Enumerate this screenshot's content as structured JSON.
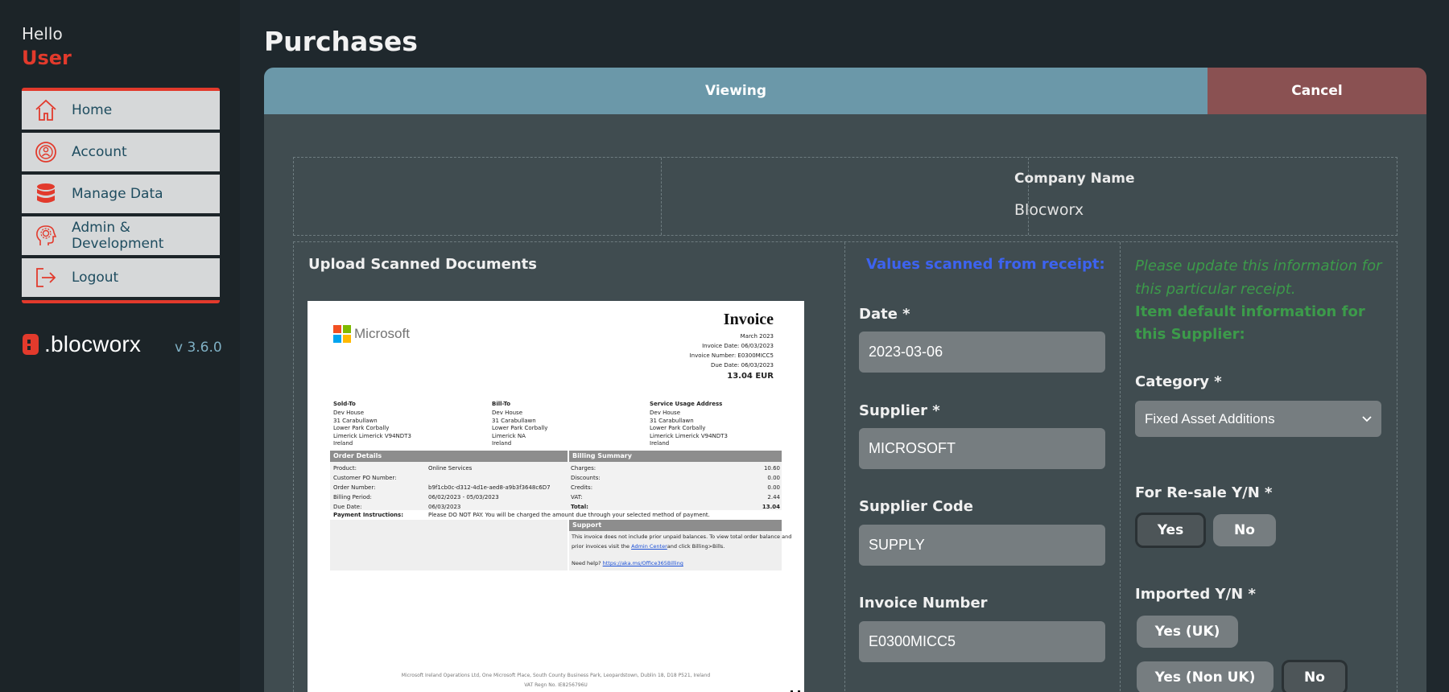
{
  "sidebar": {
    "greeting": "Hello",
    "username": "User",
    "items": [
      {
        "label": "Home"
      },
      {
        "label": "Account"
      },
      {
        "label": "Manage Data"
      },
      {
        "label": "Admin &",
        "label2": "Development"
      },
      {
        "label": "Logout"
      }
    ],
    "brand": ".blocworx",
    "version": "v 3.6.0"
  },
  "page": {
    "title": "Purchases",
    "viewing_label": "Viewing",
    "cancel_label": "Cancel"
  },
  "company": {
    "label": "Company Name",
    "value": "Blocworx"
  },
  "upload": {
    "title": "Upload Scanned Documents"
  },
  "scanned": {
    "title": "Values scanned from receipt:",
    "fields": {
      "date_label": "Date *",
      "date_value": "2023-03-06",
      "supplier_label": "Supplier *",
      "supplier_value": "MICROSOFT",
      "supplier_code_label": "Supplier Code",
      "supplier_code_value": "SUPPLY",
      "invoice_number_label": "Invoice Number",
      "invoice_number_value": "E0300MICC5"
    }
  },
  "defaults": {
    "hint_italic": "Please update this information for this particular receipt.",
    "hint_bold": "Item default information for this Supplier:",
    "category_label": "Category *",
    "category_value": "Fixed Asset Additions",
    "resale_label": "For Re-sale Y/N *",
    "resale_yes": "Yes",
    "resale_no": "No",
    "imported_label": "Imported Y/N *",
    "imported_yes_uk": "Yes (UK)",
    "imported_yes_non_uk": "Yes (Non UK)",
    "imported_no": "No"
  },
  "invoice_doc": {
    "vendor": "Microsoft",
    "heading": "Invoice",
    "month": "March 2023",
    "invoice_date": "Invoice Date: 06/03/2023",
    "invoice_number": "Invoice Number: E0300MICC5",
    "due_date": "Due Date: 06/03/2023",
    "total": "13.04 EUR",
    "sold_to_h": "Sold-To",
    "bill_to_h": "Bill-To",
    "service_h": "Service Usage Address",
    "addr1": [
      "Dev House",
      "31 Carabullawn",
      "Lower Park Corbally",
      "Limerick Limerick V94NDT3",
      "Ireland"
    ],
    "addr2": [
      "Dev House",
      "31 Carabullawn",
      "Lower Park Corbally",
      "Limerick  NA",
      "Ireland"
    ],
    "addr3": [
      "Dev House",
      "31 Carabullawn",
      "Lower Park Corbally",
      "Limerick Limerick V94NDT3",
      "Ireland"
    ],
    "order_details_h": "Order Details",
    "billing_summary_h": "Billing Summary",
    "od_labels": [
      "Product:",
      "Customer PO Number:",
      "Order Number:",
      "Billing Period:",
      "Due Date:"
    ],
    "od_values": [
      "Online Services",
      "",
      "b9f1cb0c-d312-4d1e-aed8-a9b3f3648c6D7",
      "06/02/2023 - 05/03/2023",
      "06/03/2023"
    ],
    "bs_labels": [
      "Charges:",
      "Discounts:",
      "Credits:",
      "VAT:",
      "Total:"
    ],
    "bs_values": [
      "10.60",
      "0.00",
      "0.00",
      "2.44",
      "13.04"
    ],
    "payment_label": "Payment Instructions:",
    "payment_text": "Please DO NOT PAY. You will be charged the amount due through your selected method of payment.",
    "support_h": "Support",
    "support_text1": "This invoice does not include prior unpaid balances. To view total order balance and",
    "support_text2": "prior invoices visit the",
    "support_link": "Admin Center",
    "support_text3": "and click Billing>Bills.",
    "need_help": "Need help?",
    "help_link": "https://aka.ms/Office365Billing",
    "footer1": "Microsoft Ireland Operations Ltd, One Microsoft Place, South County Business Park, Leopardstown, Dublin 18, D18 P521, Ireland",
    "footer2": "VAT Regn No. IE8256796U"
  },
  "colors": {
    "accent_red": "#e23a2c",
    "viewing_bar": "#6b98a9",
    "cancel_bar": "#8a5152",
    "scanned_blue": "#3d63f0",
    "hint_green": "#3c9b4a"
  }
}
